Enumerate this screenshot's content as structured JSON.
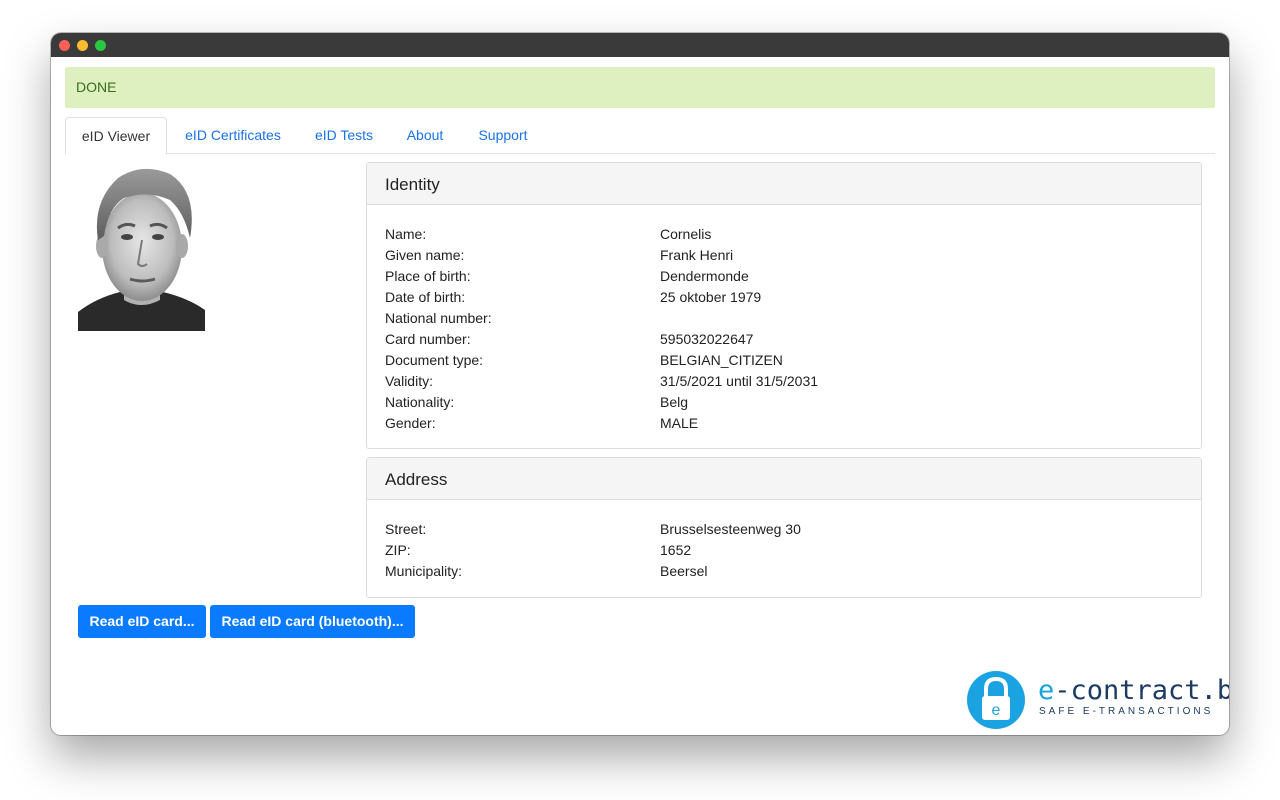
{
  "status": {
    "text": "DONE"
  },
  "tabs": [
    {
      "label": "eID Viewer",
      "active": true
    },
    {
      "label": "eID Certificates",
      "active": false
    },
    {
      "label": "eID Tests",
      "active": false
    },
    {
      "label": "About",
      "active": false
    },
    {
      "label": "Support",
      "active": false
    }
  ],
  "identity": {
    "title": "Identity",
    "rows": [
      {
        "label": "Name:",
        "value": "Cornelis"
      },
      {
        "label": "Given name:",
        "value": "Frank Henri"
      },
      {
        "label": "Place of birth:",
        "value": "Dendermonde"
      },
      {
        "label": "Date of birth:",
        "value": "25 oktober 1979"
      },
      {
        "label": "National number:",
        "value": ""
      },
      {
        "label": "Card number:",
        "value": "595032022647"
      },
      {
        "label": "Document type:",
        "value": "BELGIAN_CITIZEN"
      },
      {
        "label": "Validity:",
        "value": "31/5/2021 until 31/5/2031"
      },
      {
        "label": "Nationality:",
        "value": "Belg"
      },
      {
        "label": "Gender:",
        "value": "MALE"
      }
    ]
  },
  "address": {
    "title": "Address",
    "rows": [
      {
        "label": "Street:",
        "value": "Brusselsesteenweg 30"
      },
      {
        "label": "ZIP:",
        "value": "1652"
      },
      {
        "label": "Municipality:",
        "value": "Beersel"
      }
    ]
  },
  "buttons": {
    "read_card": "Read eID card...",
    "read_card_bluetooth": "Read eID card (bluetooth)..."
  },
  "logo": {
    "main_prefix": "e",
    "main_rest": "-contract.be",
    "tagline": "SAFE E-TRANSACTIONS",
    "badge_letter": "e"
  },
  "colors": {
    "alert_bg": "#dff0c0",
    "alert_text": "#3c6b1f",
    "link": "#1a73e8",
    "button": "#0a7bff",
    "logo_blue": "#1aa3e0",
    "logo_navy": "#1c3b63"
  }
}
